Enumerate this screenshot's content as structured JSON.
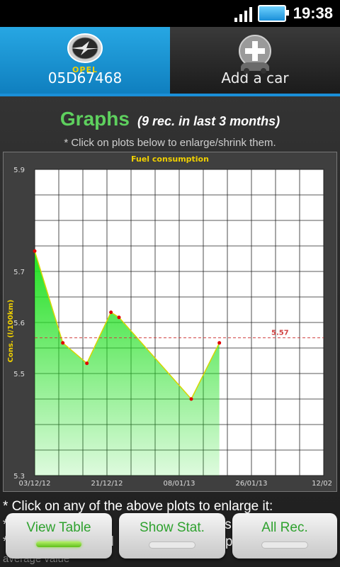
{
  "status": {
    "time": "19:38"
  },
  "tabs": [
    {
      "logo_text": "OPEL",
      "label": "05D67468",
      "icon": "opel-logo"
    },
    {
      "label": "Add a car",
      "icon": "add-car-icon"
    }
  ],
  "header": {
    "title": "Graphs",
    "subtitle": "(9 rec. in last 3 months)",
    "hint": "* Click on plots below to enlarge/shrink them."
  },
  "chart_data": {
    "type": "area",
    "title": "Fuel consumption",
    "ylabel": "Cons. (l/100km)",
    "xlabel": "",
    "ylim": [
      5.3,
      5.9
    ],
    "yticks": [
      "5.9",
      "5.7",
      "5.6",
      "5.5",
      "5.3"
    ],
    "xticks": [
      "03/12/12",
      "21/12/12",
      "08/01/13",
      "26/01/13",
      "12/02"
    ],
    "x": [
      "03/12/12",
      "10/12/12",
      "16/12/12",
      "22/12/12",
      "24/12/12",
      "11/01/13",
      "18/01/13"
    ],
    "values": [
      5.74,
      5.56,
      5.52,
      5.62,
      5.61,
      5.45,
      5.56
    ],
    "average": 5.57,
    "average_label": "5.57",
    "colors": {
      "line": "#d6d600",
      "point": "#e00000",
      "fill": "#22e022",
      "average": "#d04040"
    }
  },
  "footer": {
    "text1": "* Click on any of the above plots to enlarge it:",
    "text2": "et",
    "text3": "ts",
    "text4": "d",
    "text5": "p",
    "text6": "average value"
  },
  "buttons": [
    {
      "label": "View Table",
      "active": true
    },
    {
      "label": "Show Stat.",
      "active": false
    },
    {
      "label": "All Rec.",
      "active": false
    }
  ]
}
